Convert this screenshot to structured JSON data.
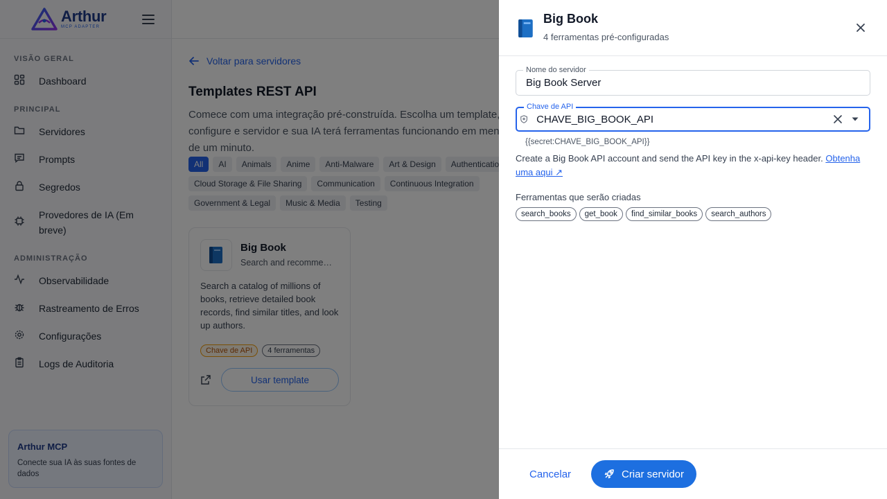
{
  "brand": {
    "name": "Arthur",
    "subtitle": "MCP ADAPTER"
  },
  "sidebar": {
    "sections": [
      {
        "label": "VISÃO GERAL"
      },
      {
        "label": "PRINCIPAL"
      },
      {
        "label": "ADMINISTRAÇÃO"
      }
    ],
    "items": [
      {
        "label": "Dashboard",
        "icon": "dashboard-icon"
      },
      {
        "label": "Servidores",
        "icon": "folder-icon"
      },
      {
        "label": "Prompts",
        "icon": "chat-icon"
      },
      {
        "label": "Segredos",
        "icon": "lock-icon"
      },
      {
        "label": "Provedores de IA (Em breve)",
        "icon": "chip-icon"
      },
      {
        "label": "Observabilidade",
        "icon": "activity-icon"
      },
      {
        "label": "Rastreamento de Erros",
        "icon": "bug-icon"
      },
      {
        "label": "Configurações",
        "icon": "gear-icon"
      },
      {
        "label": "Logs de Auditoria",
        "icon": "clipboard-icon"
      }
    ],
    "promo": {
      "title": "Arthur MCP",
      "text": "Conecte sua IA às suas fontes de dados"
    }
  },
  "main": {
    "back_label": "Voltar para servidores",
    "title": "Templates REST API",
    "description": "Comece com uma integração pré-construída. Escolha um template, configure e servidor e sua IA terá ferramentas funcionando em menos de um minuto.",
    "categories": [
      "All",
      "AI",
      "Animals",
      "Anime",
      "Anti-Malware",
      "Art & Design",
      "Authentication",
      "Cloud Storage & File Sharing",
      "Communication",
      "Continuous Integration",
      "Government & Legal",
      "Music & Media",
      "Testing"
    ],
    "card": {
      "title": "Big Book",
      "subtitle": "Search and recommend books",
      "description": "Search a catalog of millions of books, retrieve detailed book records, find similar titles, and look up authors.",
      "tag_auth": "Chave de API",
      "tag_tools": "4 ferramentas",
      "use_label": "Usar template"
    }
  },
  "drawer": {
    "title": "Big Book",
    "subtitle": "4 ferramentas pré-configuradas",
    "name_field": {
      "label": "Nome do servidor",
      "value": "Big Book Server"
    },
    "api_field": {
      "label": "Chave de API",
      "value": "CHAVE_BIG_BOOK_API"
    },
    "secret_hint": "{{secret:CHAVE_BIG_BOOK_API}}",
    "help_text": "Create a Big Book API account and send the API key in the x-api-key header.",
    "help_link": "Obtenha uma aqui ↗",
    "tools_label": "Ferramentas que serão criadas",
    "tools": [
      "search_books",
      "get_book",
      "find_similar_books",
      "search_authors"
    ],
    "cancel_label": "Cancelar",
    "create_label": "Criar servidor"
  },
  "colors": {
    "accent": "#2563eb",
    "overlay": "rgba(0,0,0,0.5)"
  }
}
